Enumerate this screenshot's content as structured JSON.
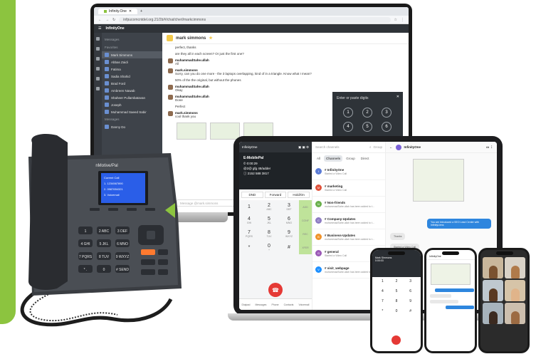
{
  "browser": {
    "tab_title": "Infinity.One",
    "url": "infpucomcntdel.org.21/2b/#/chat/cherl/markcimmons"
  },
  "laptop_app": {
    "brand": "InfinityOne",
    "sidebar_heading": "Messages",
    "section_favorites": "Favorites",
    "conversations": [
      {
        "name": "Mark Simmons",
        "active": true
      },
      {
        "name": "Abbas Zaidi"
      },
      {
        "name": "Fatima"
      },
      {
        "name": "Sadia Shahid"
      },
      {
        "name": "Brad Ford"
      },
      {
        "name": "Ambreen Nawab"
      },
      {
        "name": "Shaheer Pullambatavan"
      },
      {
        "name": "Joseph"
      },
      {
        "name": "Muhammad Saeed Sabir"
      }
    ],
    "section_more": "Messages",
    "conversation_more": "Danny Do",
    "chat_title": "mark simmons",
    "messages": [
      {
        "author": "",
        "text": "perfect, thanks"
      },
      {
        "author": "",
        "text": "are they all in each screen? Or just the first one?"
      },
      {
        "author": "muhammadSahe.ullah",
        "text": "All"
      },
      {
        "author": "mark.simmons",
        "text": "Sorry, can you do one more - the 3 laptops overlapping, kind of in a triangle. Know what I mean?"
      },
      {
        "author": "",
        "text": "50% of the the original, but without the phones"
      },
      {
        "author": "muhammadSahe.ullah",
        "text": "Okay"
      },
      {
        "author": "muhammadSahe.ullah",
        "text": "Done"
      },
      {
        "author": "",
        "text": "Perfect"
      },
      {
        "author": "mark.simmons",
        "text": "cool thank you"
      }
    ],
    "input_placeholder": "Message @mark.simmons",
    "dialer_placeholder": "Enter or paste digits",
    "dialer_keys": [
      "1",
      "2",
      "3",
      "4",
      "5",
      "6",
      "7",
      "8",
      "9",
      "*",
      "0",
      "#"
    ]
  },
  "tablet_app": {
    "header": "InfinityOne",
    "call_title": "E-MobilePal",
    "call_lines": [
      "© 0:00:29",
      "@2@ gfg 48/adder",
      "ⓘ 2152 588 3817"
    ],
    "call_buttons": [
      "DND",
      "Forward",
      "Hold/On"
    ],
    "keys": [
      {
        "d": "1",
        "s": ""
      },
      {
        "d": "2",
        "s": "ABC"
      },
      {
        "d": "3",
        "s": "DEF"
      },
      {
        "d": "4",
        "s": "GHI"
      },
      {
        "d": "5",
        "s": "JKL"
      },
      {
        "d": "6",
        "s": "MNO"
      },
      {
        "d": "7",
        "s": "PQRS"
      },
      {
        "d": "8",
        "s": "TUV"
      },
      {
        "d": "9",
        "s": "WXYZ"
      },
      {
        "d": "*",
        "s": ""
      },
      {
        "d": "0",
        "s": "+"
      },
      {
        "d": "#",
        "s": ""
      }
    ],
    "side_labels": [
      "ADD",
      "CONF",
      "REC",
      "XFER",
      "MUTE"
    ],
    "nav": [
      "Dialpad",
      "Messages",
      "Phone",
      "Contacts",
      "Voicemail"
    ],
    "search_placeholder": "Search channels",
    "group_label": "Group",
    "filters": [
      "All",
      "Channels",
      "Group",
      "Direct"
    ],
    "channels": [
      {
        "name": "# InfinityOne",
        "sub": "Started a Video Call",
        "color": "#5b7bd5",
        "initial": "I"
      },
      {
        "name": "# marketing",
        "sub": "Started a Video Call",
        "color": "#e0523b",
        "initial": "M"
      },
      {
        "name": "# Non-friends",
        "sub": "muhammadSahe.ullah has been added to t...",
        "color": "#6ab04c",
        "initial": "N"
      },
      {
        "name": "# Company-Updates",
        "sub": "muhammadSahe.ullah has been added to t...",
        "color": "#8e7cc3",
        "initial": "C"
      },
      {
        "name": "# Business-Updates",
        "sub": "muhammadSahe.ullah has been added to t...",
        "color": "#f0932b",
        "initial": "B"
      },
      {
        "name": "# general",
        "sub": "Started a Video Call",
        "color": "#9b59b6",
        "initial": "G"
      },
      {
        "name": "# visit_webpage",
        "sub": "muhammadSahe.ullah has been added to t...",
        "color": "#1e90ff",
        "initial": "V"
      }
    ],
    "chat_title": "InfinityOne",
    "bubble_1": "You are introduced a SEO Lead Center with InfinityLiens",
    "bubble_2": "Thanks",
    "bubble_3": "Started a Video Call"
  },
  "phones": {
    "time": "0:00:03",
    "call_name": "Mark Simmons",
    "chat_title": "InfinityOne",
    "keys": [
      "1",
      "2",
      "3",
      "4",
      "5",
      "6",
      "7",
      "8",
      "9",
      "*",
      "0",
      "#"
    ]
  },
  "desk_phone": {
    "brand": "nMotive/Pal",
    "screen_lines": [
      "Current Call",
      "1. 1234567890",
      "2. 0987654321",
      "3. Voicemail"
    ],
    "keys": [
      "1",
      "2 ABC",
      "3 DEF",
      "4 GHI",
      "5 JKL",
      "6 MNO",
      "7 PQRS",
      "8 TUV",
      "9 WXYZ",
      "* .",
      "0",
      "# SEND"
    ]
  },
  "colors": {
    "brand_green": "#8cc43f",
    "dark_chrome": "#2f3338",
    "hangup_red": "#e53935",
    "link_blue": "#2e86de"
  }
}
